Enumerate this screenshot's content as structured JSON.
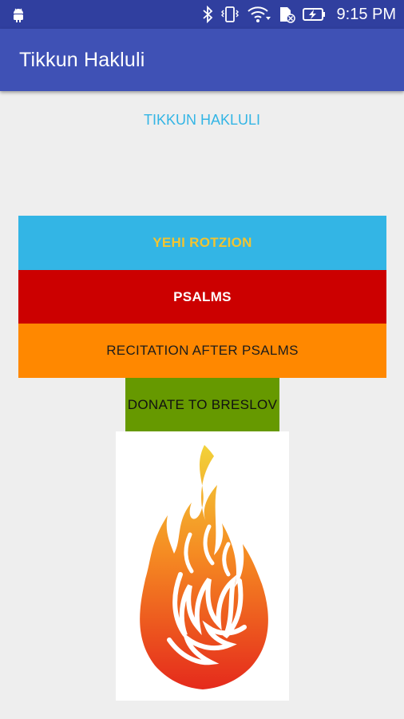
{
  "status_bar": {
    "time": "9:15 PM",
    "icons": [
      "android-icon",
      "bluetooth-icon",
      "vibrate-icon",
      "wifi-icon",
      "sim-icon",
      "battery-charging-icon"
    ]
  },
  "app_bar": {
    "title": "Tikkun Hakluli"
  },
  "main": {
    "subtitle": "TIKKUN HAKLULI",
    "buttons": {
      "yehi_rotzion": "YEHI ROTZION",
      "psalms": "PSALMS",
      "recitation": "RECITATION AFTER PSALMS",
      "donate": "DONATE TO BRESLOV"
    },
    "image": "flame-logo"
  },
  "colors": {
    "status_bar": "#303f9f",
    "app_bar": "#3f51b5",
    "background": "#eeeeee",
    "subtitle": "#33b5e5",
    "yehi_bg": "#33b5e5",
    "yehi_text": "#f3c430",
    "psalms_bg": "#cc0000",
    "recitation_bg": "#ff8800",
    "donate_bg": "#669900"
  }
}
